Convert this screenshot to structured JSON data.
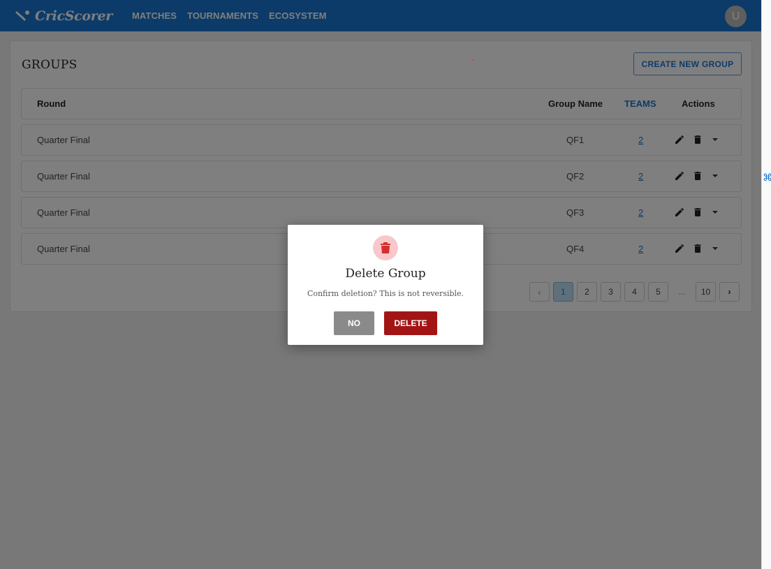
{
  "app": {
    "name": "CricScorer",
    "logo_icon": "cricket-bat-icon",
    "nav": [
      "MATCHES",
      "TOURNAMENTS",
      "ECOSYSTEM"
    ],
    "avatar_initial": "U",
    "brand_color": "#1976d2"
  },
  "page": {
    "title": "GROUPS",
    "create_button": "CREATE NEW GROUP"
  },
  "table": {
    "headers": {
      "round": "Round",
      "group_name": "Group Name",
      "teams": "TEAMS",
      "actions": "Actions"
    },
    "rows": [
      {
        "round": "Quarter Final",
        "group_name": "QF1",
        "teams": "2"
      },
      {
        "round": "Quarter Final",
        "group_name": "QF2",
        "teams": "2"
      },
      {
        "round": "Quarter Final",
        "group_name": "QF3",
        "teams": "2"
      },
      {
        "round": "Quarter Final",
        "group_name": "QF4",
        "teams": "2"
      }
    ],
    "row_actions": [
      "edit-icon",
      "delete-icon",
      "caret-down-icon"
    ]
  },
  "pagination": {
    "prev": "‹",
    "pages": [
      "1",
      "2",
      "3",
      "4",
      "5"
    ],
    "ellipsis": "...",
    "last": "10",
    "next": "›",
    "current": "1"
  },
  "modal": {
    "icon": "trash-icon",
    "title": "Delete Group",
    "message": "Confirm deletion? This is not reversible.",
    "no_label": "NO",
    "delete_label": "DELETE",
    "delete_color": "#a31515"
  }
}
